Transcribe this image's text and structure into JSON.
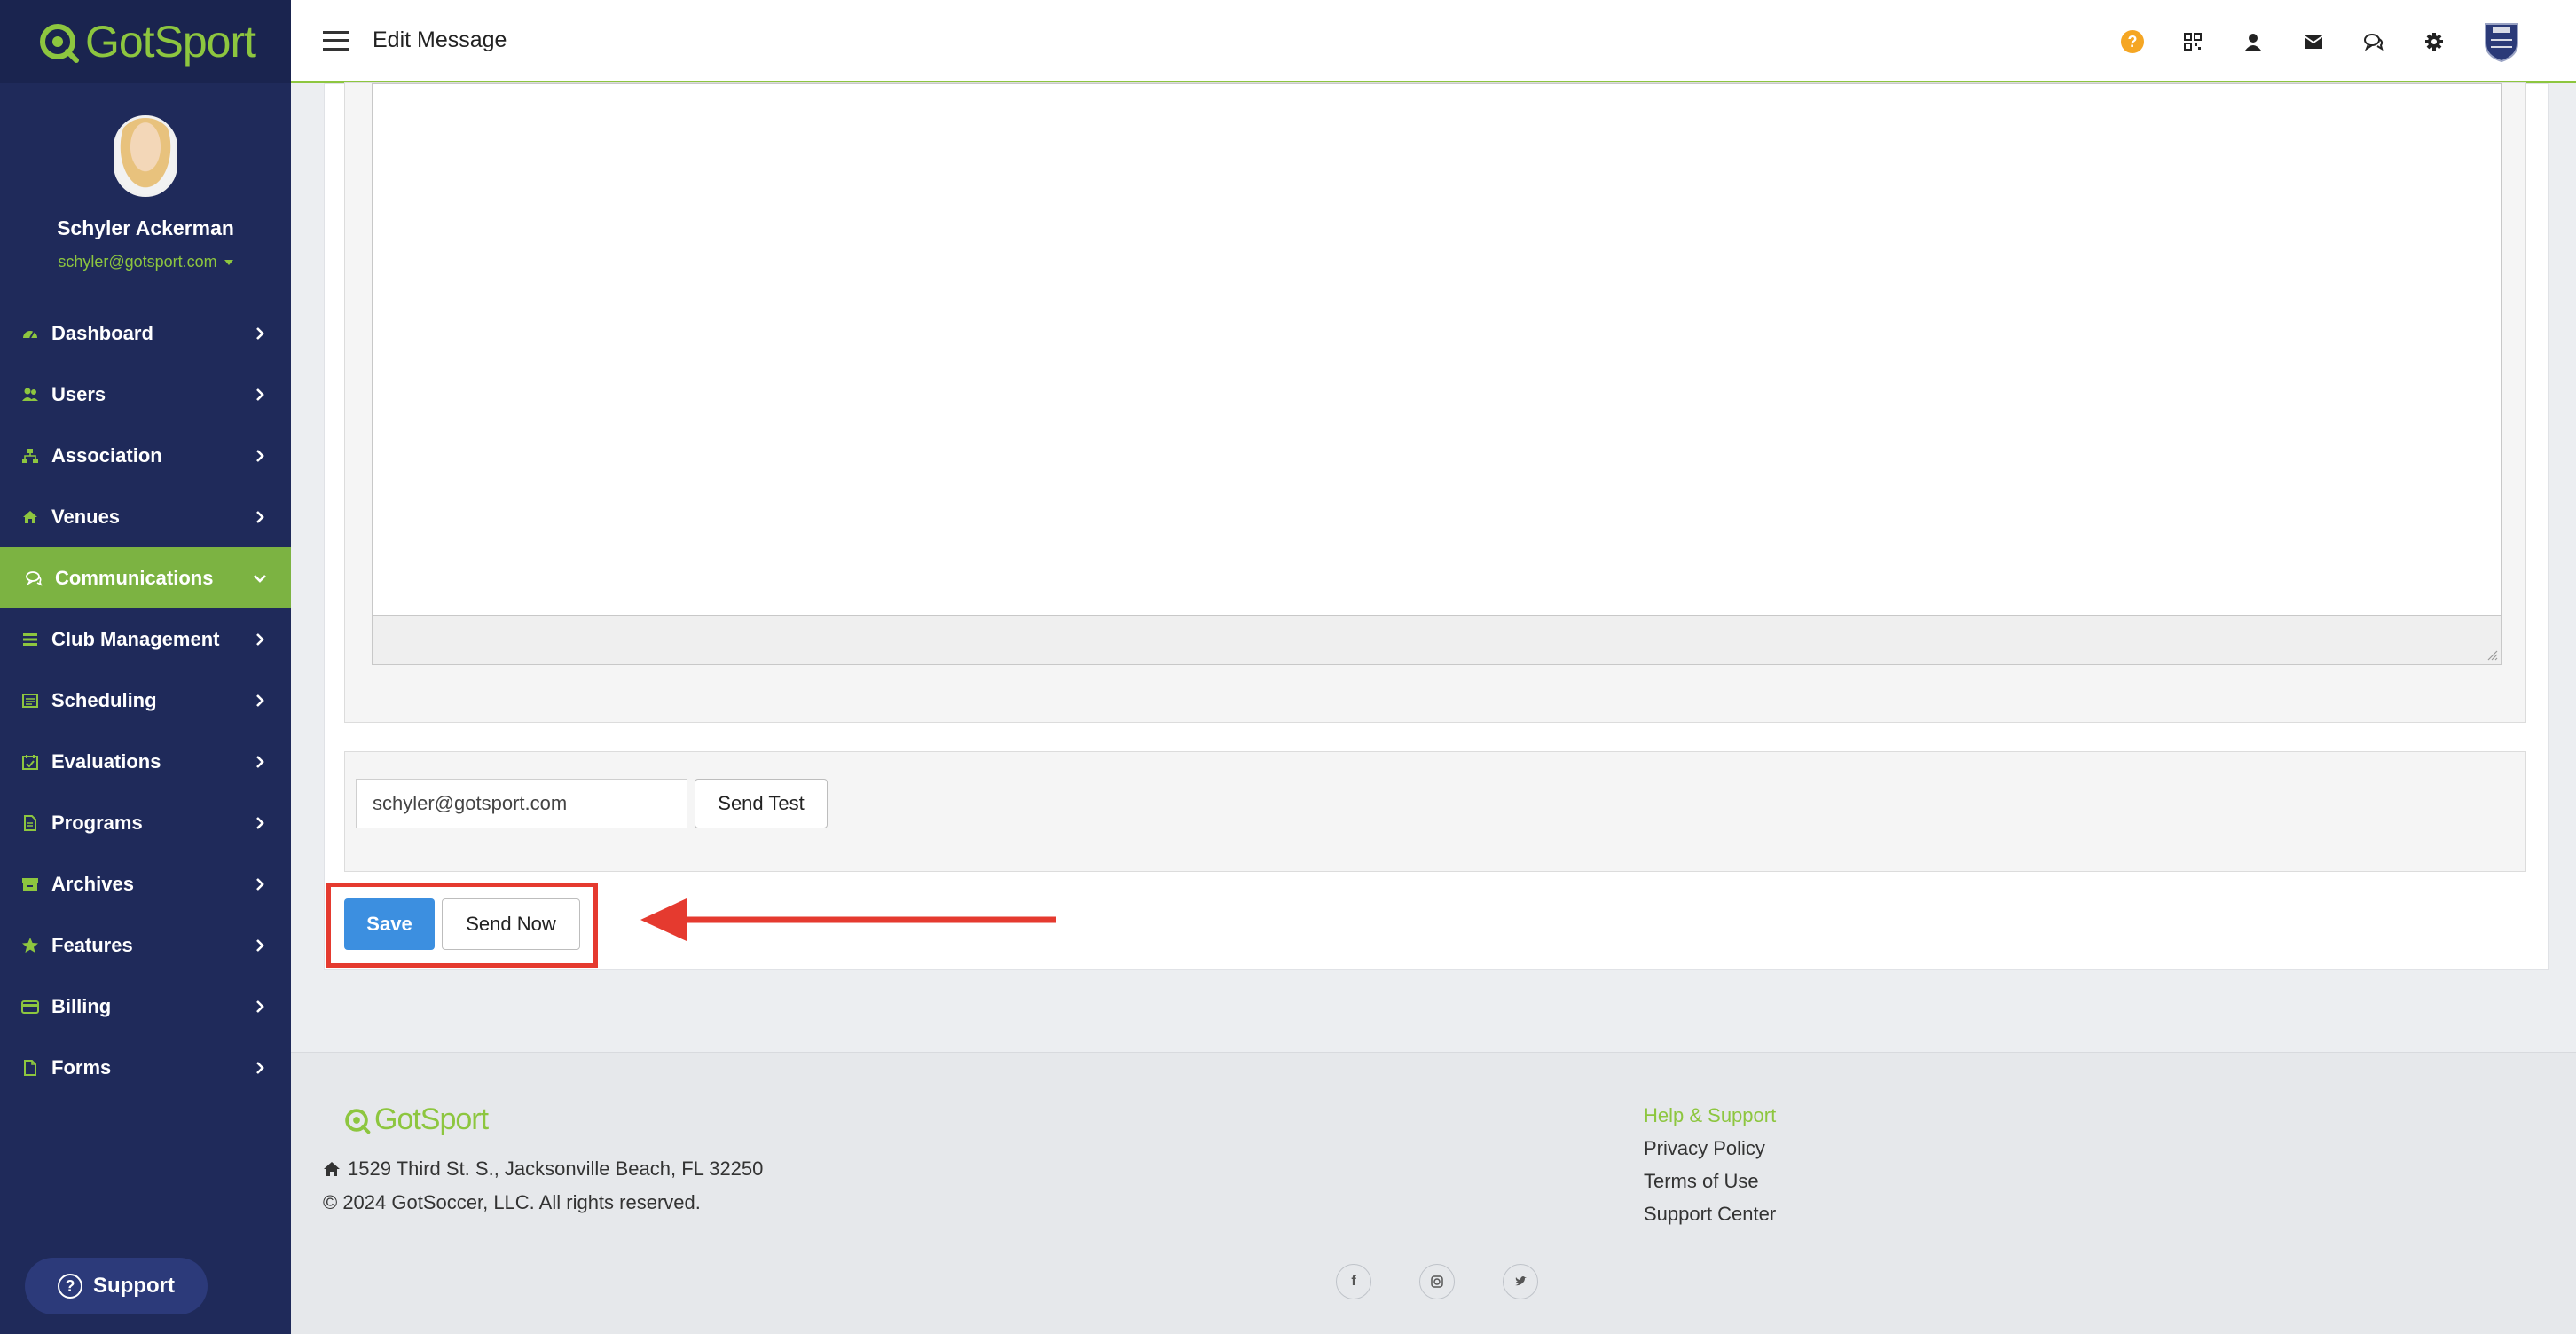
{
  "brand": {
    "name": "GotSport"
  },
  "user": {
    "name": "Schyler Ackerman",
    "email": "schyler@gotsport.com"
  },
  "nav": [
    {
      "label": "Dashboard",
      "icon": "dashboard-icon"
    },
    {
      "label": "Users",
      "icon": "users-icon"
    },
    {
      "label": "Association",
      "icon": "sitemap-icon"
    },
    {
      "label": "Venues",
      "icon": "home-icon"
    },
    {
      "label": "Communications",
      "icon": "chat-icon",
      "active": true
    },
    {
      "label": "Club Management",
      "icon": "list-icon"
    },
    {
      "label": "Scheduling",
      "icon": "calendar-list-icon"
    },
    {
      "label": "Evaluations",
      "icon": "calendar-check-icon"
    },
    {
      "label": "Programs",
      "icon": "document-icon"
    },
    {
      "label": "Archives",
      "icon": "archive-icon"
    },
    {
      "label": "Features",
      "icon": "star-icon"
    },
    {
      "label": "Billing",
      "icon": "credit-card-icon"
    },
    {
      "label": "Forms",
      "icon": "file-icon"
    }
  ],
  "support": {
    "label": "Support"
  },
  "header": {
    "title": "Edit Message"
  },
  "colors": {
    "accent": "#8dc63f",
    "sidebar": "#1f2a5a",
    "primary_button": "#3c8fe0",
    "highlight": "#e53a2f",
    "help": "#f5a623"
  },
  "test": {
    "email_value": "schyler@gotsport.com",
    "send_test_label": "Send Test"
  },
  "actions": {
    "save_label": "Save",
    "send_now_label": "Send Now"
  },
  "footer": {
    "logo_text": "GotSport",
    "address": "1529 Third St. S., Jacksonville Beach, FL 32250",
    "copyright": "© 2024 GotSoccer, LLC. All rights reserved.",
    "links": {
      "help": "Help & Support",
      "privacy": "Privacy Policy",
      "terms": "Terms of Use",
      "center": "Support Center"
    },
    "social": [
      "facebook-icon",
      "instagram-icon",
      "twitter-icon"
    ]
  }
}
